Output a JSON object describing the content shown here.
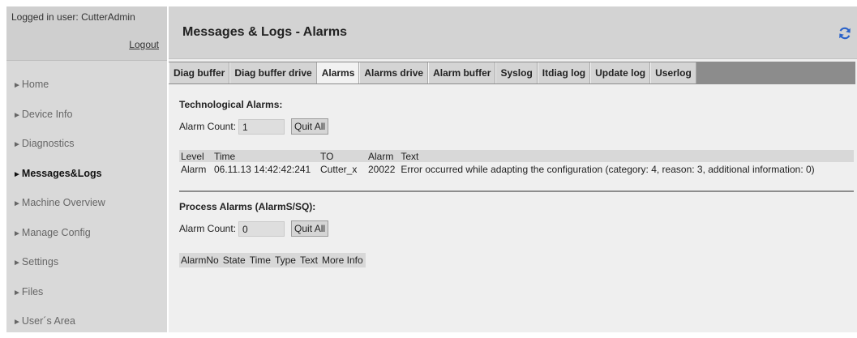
{
  "login": {
    "user_text": "Logged in user: CutterAdmin",
    "logout_label": "Logout"
  },
  "sidebar": {
    "items": [
      {
        "label": "Home",
        "active": false
      },
      {
        "label": "Device Info",
        "active": false
      },
      {
        "label": "Diagnostics",
        "active": false
      },
      {
        "label": "Messages&Logs",
        "active": true
      },
      {
        "label": "Machine Overview",
        "active": false
      },
      {
        "label": "Manage Config",
        "active": false
      },
      {
        "label": "Settings",
        "active": false
      },
      {
        "label": "Files",
        "active": false
      },
      {
        "label": "User´s Area",
        "active": false
      }
    ]
  },
  "header": {
    "title": "Messages & Logs - Alarms",
    "refresh_icon": "refresh-icon"
  },
  "tabs": [
    {
      "label": "Diag buffer",
      "active": false
    },
    {
      "label": "Diag buffer drive",
      "active": false
    },
    {
      "label": "Alarms",
      "active": true
    },
    {
      "label": "Alarms drive",
      "active": false
    },
    {
      "label": "Alarm buffer",
      "active": false
    },
    {
      "label": "Syslog",
      "active": false
    },
    {
      "label": "Itdiag log",
      "active": false
    },
    {
      "label": "Update log",
      "active": false
    },
    {
      "label": "Userlog",
      "active": false
    }
  ],
  "tech": {
    "title": "Technological Alarms:",
    "count_label": "Alarm Count:",
    "count_value": "1",
    "quit_label": "Quit All",
    "columns": [
      "Level",
      "Time",
      "TO",
      "Alarm",
      "Text"
    ],
    "rows": [
      [
        "Alarm",
        "06.11.13 14:42:42:241",
        "Cutter_x",
        "20022",
        "Error occurred while adapting the configuration (category: 4, reason: 3, additional information: 0)"
      ]
    ]
  },
  "process": {
    "title": "Process Alarms (AlarmS/SQ):",
    "count_label": "Alarm Count:",
    "count_value": "0",
    "quit_label": "Quit All",
    "columns": [
      "AlarmNo",
      "State",
      "Time",
      "Type",
      "Text",
      "More Info"
    ]
  },
  "colors": {
    "header_bg": "#d3d3d3",
    "sidebar_bg": "#d9d9d9",
    "tabbar_bg": "#8c8c8c",
    "refresh_icon": "#2a62c9"
  }
}
